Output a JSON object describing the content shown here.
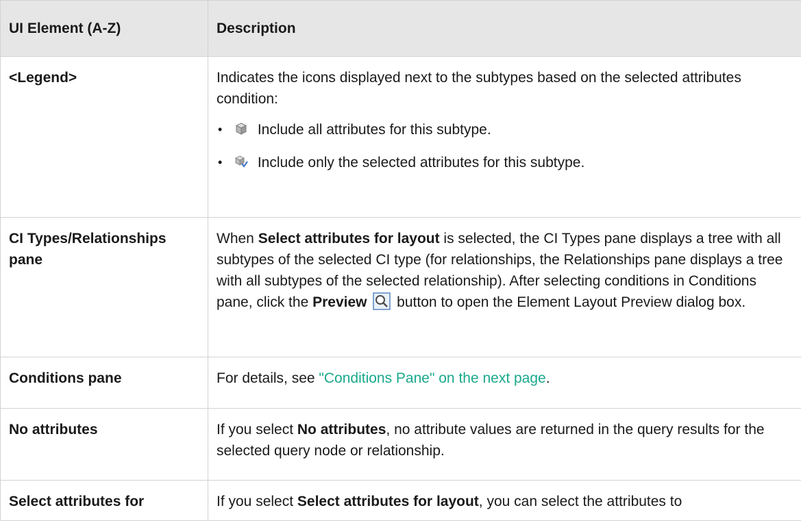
{
  "table": {
    "headers": [
      "UI Element (A-Z)",
      "Description"
    ],
    "legend_row": {
      "element": "<Legend>",
      "description": "Indicates the icons displayed next to the subtypes based on the selected attributes condition:",
      "items": [
        {
          "icon": "cube-icon",
          "text": "Include all attributes for this subtype."
        },
        {
          "icon": "cube-partial-icon",
          "text": "Include only the selected attributes for this subtype."
        }
      ]
    },
    "ci_row": {
      "element": "CI Types/Relationships pane",
      "desc_1": "When ",
      "desc_bold_1": "Select attributes for layout",
      "desc_2": " is selected, the CI Types pane displays a tree with all subtypes of the selected CI type (for relationships, the Relationships pane displays a tree with all subtypes of the selected relationship). After selecting conditions in Conditions pane, click the ",
      "desc_bold_2": "Preview",
      "desc_icon": "magnifier-icon",
      "desc_3": " button to open the Element Layout Preview dialog box."
    },
    "conditions_row": {
      "element": "Conditions pane",
      "desc_1": "For details, see ",
      "link": "\"Conditions Pane\" on the next page",
      "desc_2": "."
    },
    "no_attributes_row": {
      "element": "No attributes",
      "desc_1": "If you select ",
      "desc_bold": "No attributes",
      "desc_2": ", no attribute values are returned in the query results for the selected query node or relationship."
    },
    "select_attributes_row": {
      "element": "Select attributes for",
      "desc_1": "If you select ",
      "desc_bold": "Select attributes for layout",
      "desc_2": ", you can select the attributes to"
    }
  },
  "colors": {
    "header_bg": "#e6e6e6",
    "border": "#d2d2d2",
    "link": "#1aa88c"
  }
}
